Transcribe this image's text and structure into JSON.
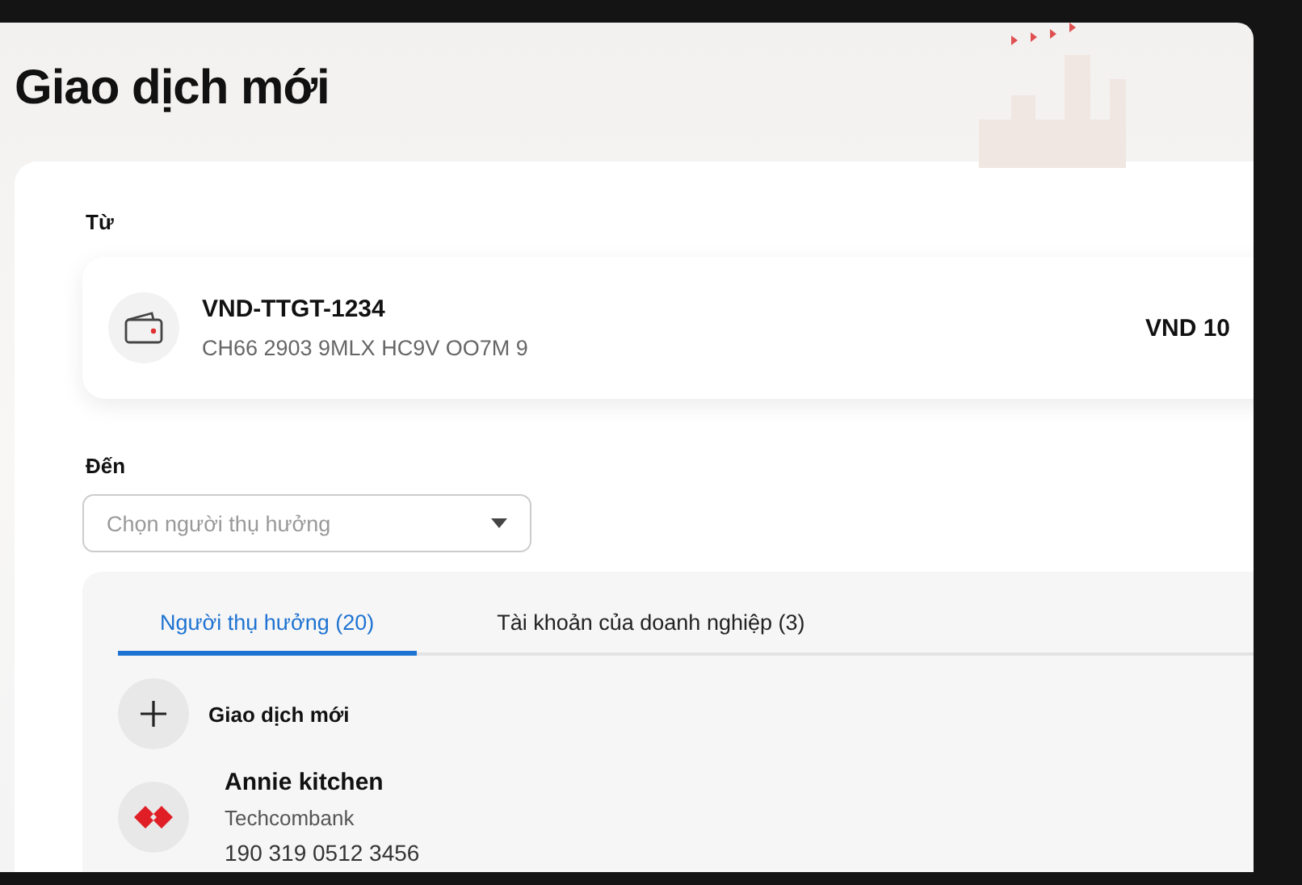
{
  "title": "Giao dịch mới",
  "from": {
    "label": "Từ",
    "account_name": "VND-TTGT-1234",
    "account_number": "CH66 2903 9MLX HC9V OO7M 9",
    "balance": "VND 10"
  },
  "to": {
    "label": "Đến",
    "select": {
      "placeholder": "Chọn người thụ hưởng"
    }
  },
  "tabs": [
    {
      "label": "Người thụ hưởng (20)",
      "selected": true
    },
    {
      "label": "Tài khoản của doanh nghiệp (3)",
      "selected": false
    }
  ],
  "new_transaction": "Giao dịch mới",
  "beneficiaries": [
    {
      "name": "Annie kitchen",
      "bank": "Techcombank",
      "account": "190 319 0512 3456"
    }
  ]
}
